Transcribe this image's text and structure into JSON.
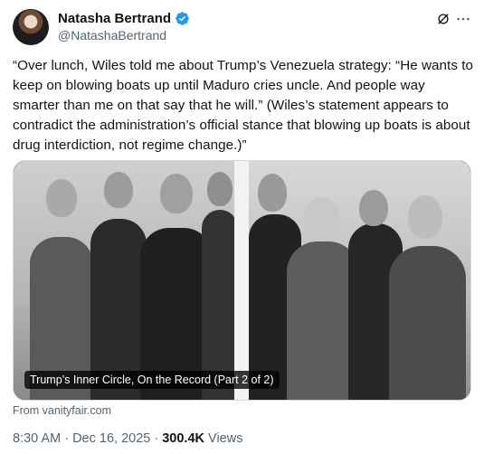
{
  "author": {
    "display_name": "Natasha Bertrand",
    "handle": "@NatashaBertrand"
  },
  "tweet": {
    "text": "“Over lunch, Wiles told me about Trump’s Venezuela strategy: “He wants to keep on blowing boats up until Maduro cries uncle. And people way smarter than me on that say that he will.” (Wiles’s statement appears to contradict the administration’s official stance that blowing up boats is about drug interdiction, not regime change.)”"
  },
  "card": {
    "caption": "Trump’s Inner Circle, On the Record (Part 2 of 2)",
    "source": "From vanityfair.com"
  },
  "meta": {
    "timestamp": "8:30 AM · Dec 16, 2025 · ",
    "views_count": "300.4K",
    "views_label": " Views"
  },
  "icons": {
    "verified": "verified-badge-icon",
    "grok": "grok-icon",
    "more": "more-icon"
  },
  "colors": {
    "verified_blue": "#1d9bf0",
    "secondary_text": "#536471",
    "primary_text": "#0f1419"
  }
}
